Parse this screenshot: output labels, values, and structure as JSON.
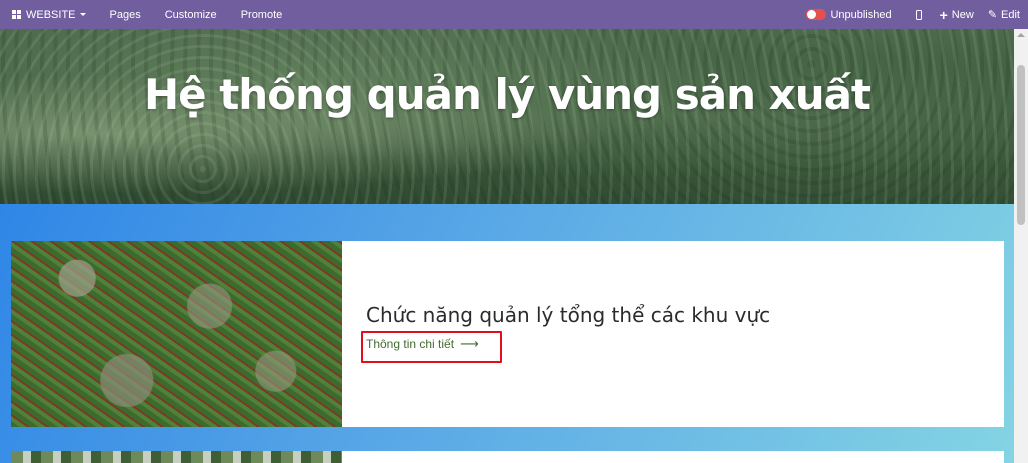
{
  "topbar": {
    "website_label": "WEBSITE",
    "menu": [
      "Pages",
      "Customize",
      "Promote"
    ],
    "publish_status": "Unpublished",
    "new_label": "New",
    "edit_label": "Edit"
  },
  "hero": {
    "title": "Hệ thống quản lý vùng sản xuất"
  },
  "card": {
    "title": "Chức năng quản lý tổng thể các khu vực",
    "link_label": "Thông tin chi tiết",
    "link_icon": "arrow-right-icon"
  },
  "colors": {
    "topbar": "#715e9f",
    "highlight": "#e0101a",
    "link": "#3f6d2f"
  }
}
